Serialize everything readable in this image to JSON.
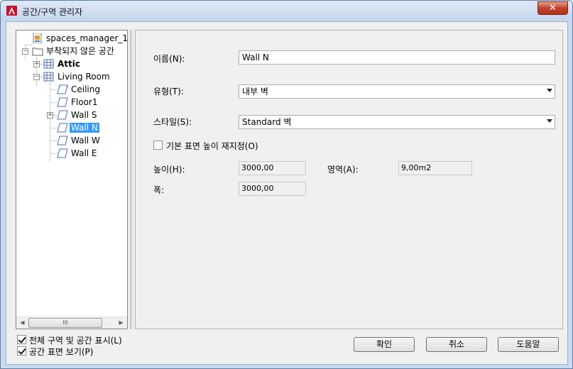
{
  "window": {
    "title": "공간/구역 관리자",
    "close_label": "✕"
  },
  "tree": {
    "root": "spaces_manager_1.dwg",
    "unattached": "부착되지 않은 공간",
    "attic": "Attic",
    "living_room": "Living Room",
    "ceiling": "Ceiling",
    "floor1": "Floor1",
    "wall_s": "Wall S",
    "wall_n": "Wall N",
    "wall_w": "Wall W",
    "wall_e": "Wall E",
    "scroll_thumb": "III"
  },
  "form": {
    "name_label": "이름(N):",
    "name_value": "Wall N",
    "type_label": "유형(T):",
    "type_value": "내부 벽",
    "style_label": "스타일(S):",
    "style_value": "Standard 벽",
    "override_label": "기본 표면 높이 재지정(O)",
    "override_checked": false,
    "height_label": "높이(H):",
    "height_value": "3000,00",
    "area_label": "영역(A):",
    "area_value": "9,00m2",
    "width_label": "폭:",
    "width_value": "3000,00"
  },
  "options": {
    "show_all_label": "전체 구역 및 공간 표시(L)",
    "show_all_checked": true,
    "show_surfaces_label": "공간 표면 보기(P)",
    "show_surfaces_checked": true
  },
  "buttons": {
    "ok": "확인",
    "cancel": "취소",
    "help": "도움말"
  },
  "colors": {
    "selection": "#3399ff",
    "titlebar": "#c3d5ec",
    "close": "#c0432c"
  }
}
